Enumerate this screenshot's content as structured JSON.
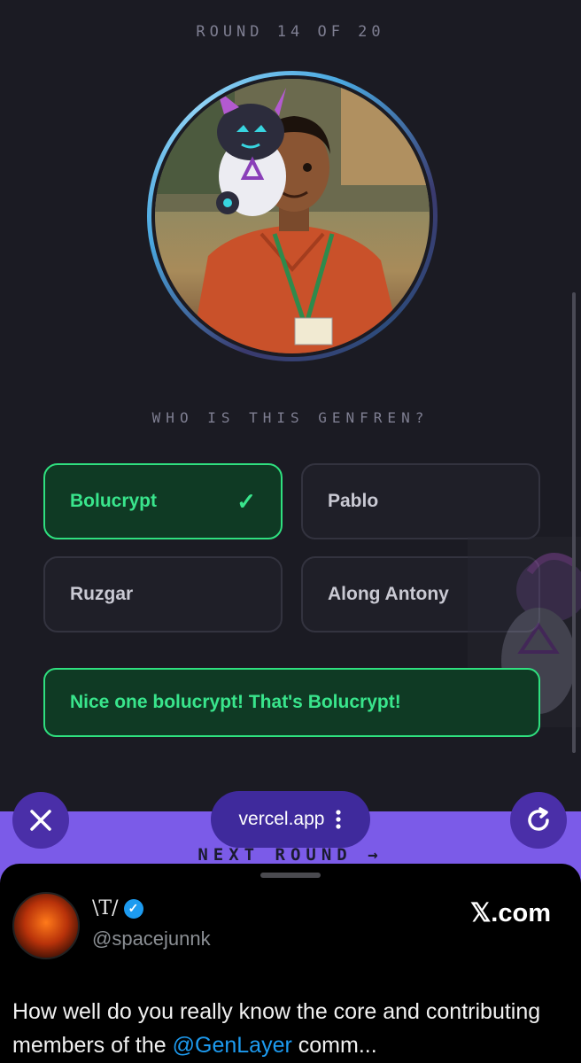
{
  "game": {
    "round_label": "ROUND 14 OF 20",
    "question": "WHO IS THIS GENFREN?",
    "options": [
      {
        "label": "Bolucrypt",
        "state": "correct"
      },
      {
        "label": "Pablo",
        "state": "default"
      },
      {
        "label": "Ruzgar",
        "state": "default"
      },
      {
        "label": "Along Antony",
        "state": "default"
      }
    ],
    "check_glyph": "✓",
    "feedback": "Nice one bolucrypt! That's Bolucrypt!",
    "next_round": "NEXT ROUND →"
  },
  "browser": {
    "close_icon": "close-icon",
    "url": "vercel.app",
    "menu_icon": "more-vertical-icon",
    "reload_icon": "reload-icon"
  },
  "tweet": {
    "display_name": "\\T/",
    "handle": "@spacejunnk",
    "site": "𝕏.com",
    "text_before": "How well do you really know the core and contributing members of the ",
    "mention": "@GenLayer",
    "text_after": " comm..."
  },
  "colors": {
    "background": "#1b1b23",
    "correct_green": "#39e58c",
    "accent_purple": "#7b5be8",
    "verified_blue": "#1d9bf0"
  }
}
